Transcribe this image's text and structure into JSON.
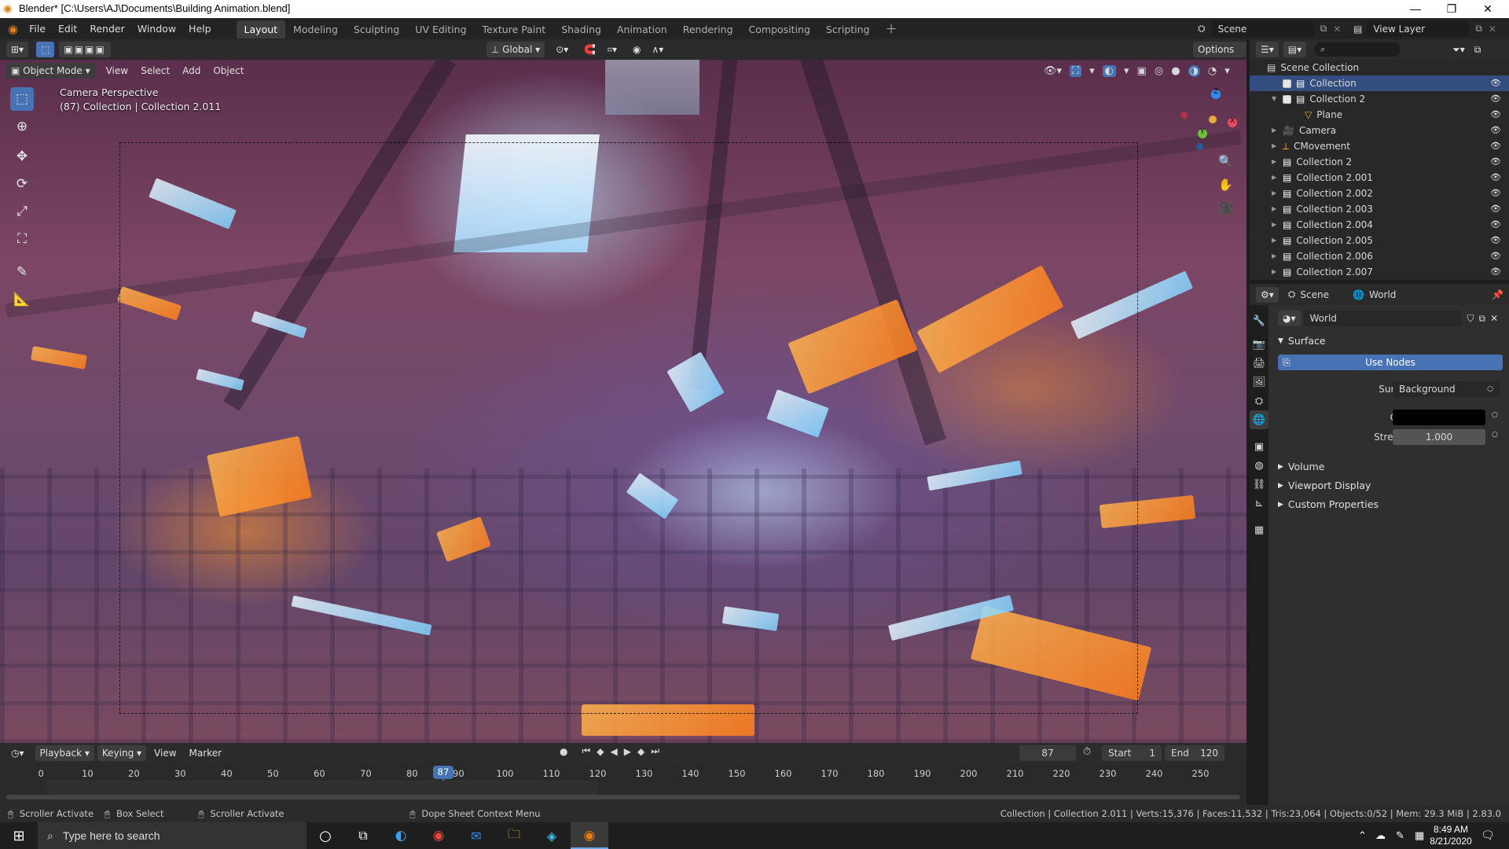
{
  "window": {
    "title": "Blender* [C:\\Users\\AJ\\Documents\\Building Animation.blend]",
    "minimize": "—",
    "maximize": "❐",
    "close": "✕"
  },
  "menu": [
    "File",
    "Edit",
    "Render",
    "Window",
    "Help"
  ],
  "workspaces": [
    "Layout",
    "Modeling",
    "Sculpting",
    "UV Editing",
    "Texture Paint",
    "Shading",
    "Animation",
    "Rendering",
    "Compositing",
    "Scripting"
  ],
  "active_workspace": "Layout",
  "scene": {
    "name": "Scene",
    "view_layer": "View Layer"
  },
  "viewport": {
    "mode": "Object Mode",
    "menus": [
      "View",
      "Select",
      "Add",
      "Object"
    ],
    "transform": "Global",
    "options": "Options",
    "overlay_title": "Camera Perspective",
    "overlay_sub": "(87) Collection | Collection 2.011",
    "gizmo": {
      "x": "X",
      "y": "Y",
      "z": "Z"
    }
  },
  "outliner": {
    "root": "Scene Collection",
    "rows": [
      {
        "label": "Collection",
        "type": "collection",
        "selected": true
      },
      {
        "label": "Collection 2",
        "type": "collection",
        "selected": false
      },
      {
        "label": "Plane",
        "type": "mesh",
        "selected": false
      },
      {
        "label": "Camera",
        "type": "camera",
        "selected": false
      },
      {
        "label": "CMovement",
        "type": "empty",
        "selected": false
      },
      {
        "label": "Collection 2",
        "type": "collection",
        "selected": false
      },
      {
        "label": "Collection 2.001",
        "type": "collection",
        "selected": false
      },
      {
        "label": "Collection 2.002",
        "type": "collection",
        "selected": false
      },
      {
        "label": "Collection 2.003",
        "type": "collection",
        "selected": false
      },
      {
        "label": "Collection 2.004",
        "type": "collection",
        "selected": false
      },
      {
        "label": "Collection 2.005",
        "type": "collection",
        "selected": false
      },
      {
        "label": "Collection 2.006",
        "type": "collection",
        "selected": false
      },
      {
        "label": "Collection 2.007",
        "type": "collection",
        "selected": false
      }
    ]
  },
  "properties": {
    "breadcrumb_scene": "Scene",
    "breadcrumb_world": "World",
    "world_name": "World",
    "surface_header": "Surface",
    "use_nodes": "Use Nodes",
    "surface_label": "Surface",
    "surface_value": "Background",
    "color_label": "Color",
    "color_value": "#000000",
    "strength_label": "Strength",
    "strength_value": "1.000",
    "sections": [
      "Volume",
      "Viewport Display",
      "Custom Properties"
    ]
  },
  "timeline": {
    "menus": [
      "Playback",
      "Keying",
      "View",
      "Marker"
    ],
    "current_frame": "87",
    "start_label": "Start",
    "start": "1",
    "end_label": "End",
    "end": "120",
    "ticks": [
      "0",
      "10",
      "20",
      "30",
      "40",
      "50",
      "60",
      "70",
      "80",
      "90",
      "100",
      "110",
      "120",
      "130",
      "140",
      "150",
      "160",
      "170",
      "180",
      "190",
      "200",
      "210",
      "220",
      "230",
      "240",
      "250"
    ]
  },
  "statusbar": {
    "items": [
      "Scroller Activate",
      "Box Select",
      "Scroller Activate",
      "Dope Sheet Context Menu"
    ],
    "stats": "Collection | Collection 2.011 | Verts:15,376 | Faces:11,532 | Tris:23,064 | Objects:0/52 | Mem: 29.3 MiB | 2.83.0"
  },
  "taskbar": {
    "search_placeholder": "Type here to search",
    "time": "8:49 AM",
    "date": "8/21/2020"
  },
  "colors": {
    "accent": "#4772b3",
    "selection": "#334d80",
    "orange": "#ff9a2e",
    "cyan": "#9fe0ff"
  }
}
